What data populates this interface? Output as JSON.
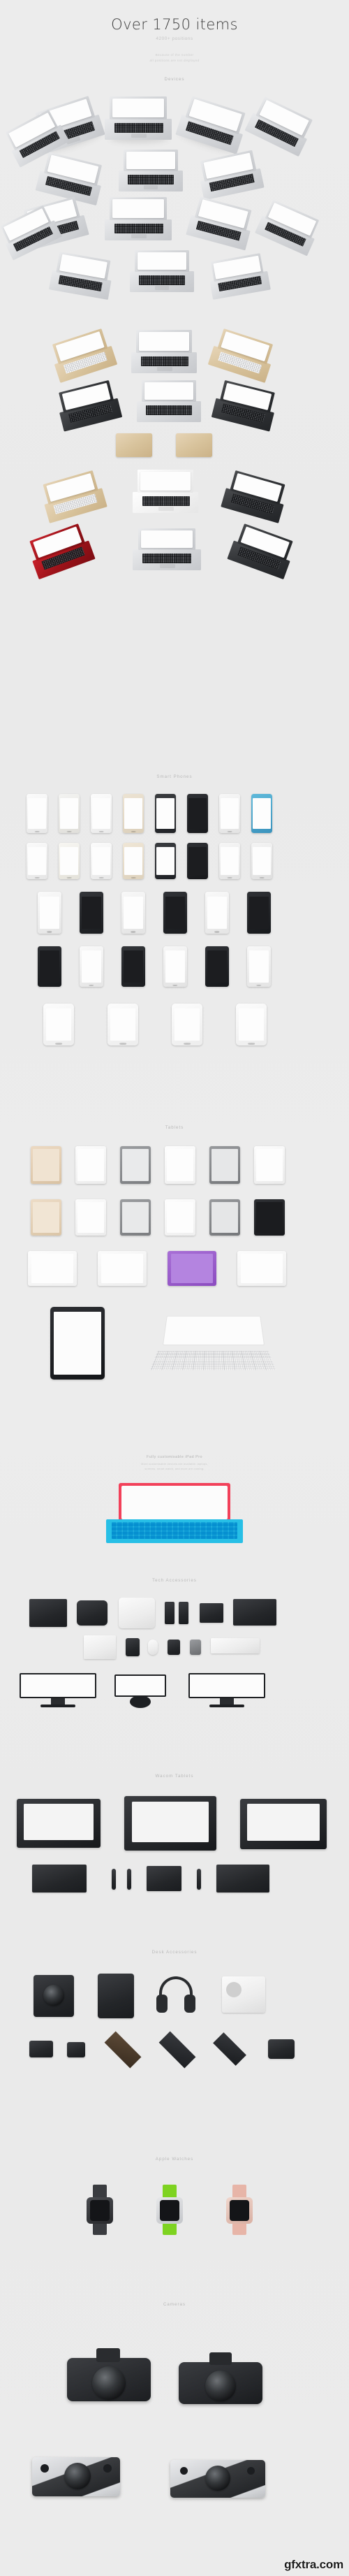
{
  "hero": {
    "title": "Over 1750 items",
    "subtitle": "4200+ positions",
    "note_line1": "Because of the number",
    "note_line2": "all positions are not displayed"
  },
  "sections": [
    {
      "id": "devices",
      "label": "Devices"
    },
    {
      "id": "smart-phones",
      "label": "Smart Phones"
    },
    {
      "id": "tablets",
      "label": "Tablets"
    },
    {
      "id": "tech-accessories",
      "label": "Tech Accessories"
    },
    {
      "id": "wacom-tablets",
      "label": "Wacom Tablets"
    },
    {
      "id": "desk-accessories",
      "label": "Desk Accessories"
    },
    {
      "id": "apple-watches",
      "label": "Apple Watches"
    },
    {
      "id": "cameras",
      "label": "Cameras"
    }
  ],
  "ipad_promo": {
    "title": "Fully customisable iPad Pro",
    "note_line1": "More customisable devices are available: laptops,",
    "note_line2": "screens, smart watch, and more are coming."
  },
  "watermark": "gfxtra.com",
  "colors": {
    "page_bg": "#ebebeb",
    "title": "#3c3c3c",
    "section_label": "#b9b9b9",
    "muted": "#cccccc",
    "accent_red": "#f2415a",
    "accent_cyan": "#27bfe6",
    "accent_green": "#7ed321",
    "accent_purple": "#9b59d0"
  }
}
